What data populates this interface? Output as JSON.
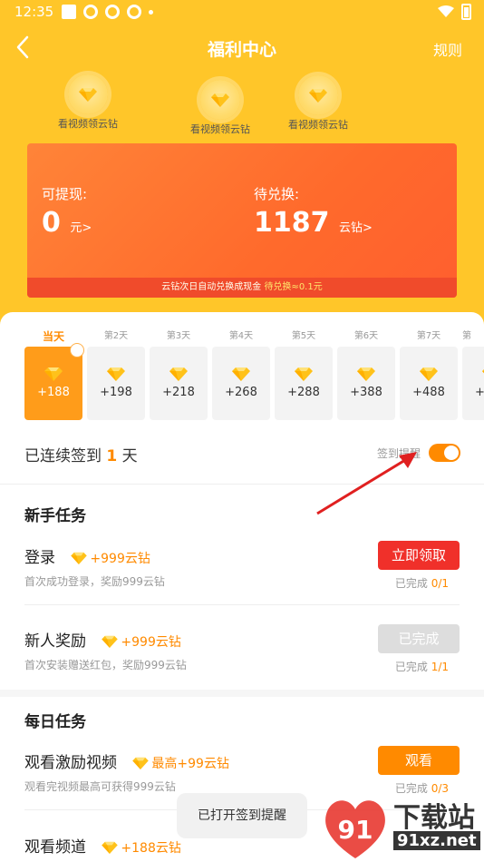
{
  "status_bar": {
    "time": "12:35"
  },
  "nav": {
    "title": "福利中心",
    "rules": "规则"
  },
  "coins": [
    {
      "label": "看视频领云钻"
    },
    {
      "label": "看视频领云钻"
    },
    {
      "label": "看视频领云钻"
    }
  ],
  "balance": {
    "withdraw_label": "可提现:",
    "withdraw_value": "0",
    "withdraw_unit": "元>",
    "pending_label": "待兑换:",
    "pending_value": "1187",
    "pending_unit": "云钻>",
    "notice": "云钻次日自动兑换成现金",
    "notice_highlight": "待兑换≈0.1元"
  },
  "checkin": {
    "days": [
      {
        "label": "当天",
        "amount": "+188"
      },
      {
        "label": "第2天",
        "amount": "+198"
      },
      {
        "label": "第3天",
        "amount": "+218"
      },
      {
        "label": "第4天",
        "amount": "+268"
      },
      {
        "label": "第5天",
        "amount": "+288"
      },
      {
        "label": "第6天",
        "amount": "+388"
      },
      {
        "label": "第7天",
        "amount": "+488"
      },
      {
        "label": "第",
        "amount": "+"
      }
    ],
    "streak_prefix": "已连续签到",
    "streak_count": "1",
    "streak_suffix": "天",
    "remind_label": "签到提醒",
    "remind_on": true
  },
  "newbie": {
    "title": "新手任务",
    "tasks": [
      {
        "name": "登录",
        "reward": "+999云钻",
        "desc": "首次成功登录，奖励999云钻",
        "button": "立即领取",
        "status_prefix": "已完成",
        "status": "0/1"
      },
      {
        "name": "新人奖励",
        "reward": "+999云钻",
        "desc": "首次安装赠送红包，奖励999云钻",
        "button": "已完成",
        "status_prefix": "已完成",
        "status": "1/1"
      }
    ]
  },
  "daily": {
    "title": "每日任务",
    "tasks": [
      {
        "name": "观看激励视频",
        "reward": "最高+99云钻",
        "desc": "观看完视频最高可获得999云钻",
        "button": "观看",
        "status_prefix": "已完成",
        "status": "0/3"
      },
      {
        "name": "观看频道",
        "reward": "+188云钻"
      }
    ]
  },
  "toast": "已打开签到提醒",
  "watermark": {
    "text": "下载站",
    "url": "91xz.net",
    "logo": "91"
  },
  "colors": {
    "header": "#ffc629",
    "accent": "#ff8a00",
    "claim": "#f0302a",
    "done": "#dddddd",
    "watch": "#ff8a00"
  }
}
